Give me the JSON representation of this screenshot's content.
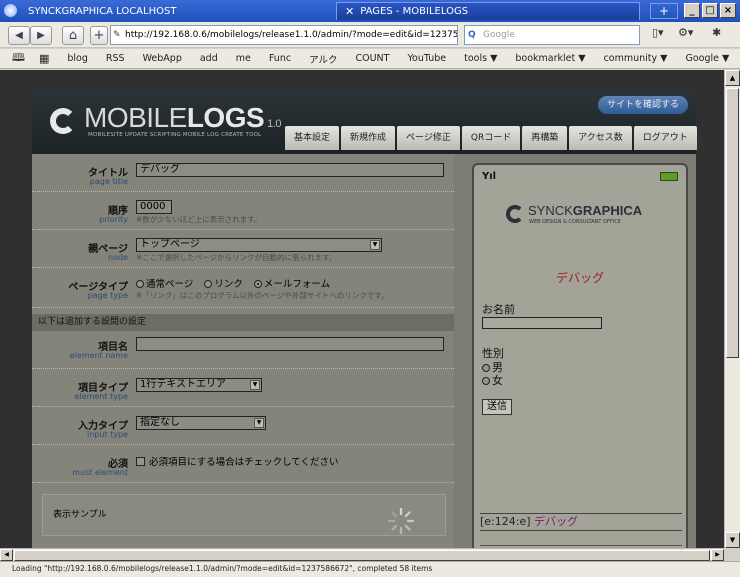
{
  "window": {
    "tab1_title": "SYNCKGRAPHICA LOCALHOST",
    "tab2_title": "PAGES - MOBILELOGS",
    "newtab_label": "+"
  },
  "nav": {
    "back": "◀",
    "forward": "▶",
    "home": "⌂",
    "add": "+",
    "url": "http://192.168.0.6/mobilelogs/release1.1.0/admin/?mode=edit&id=1237586",
    "search_placeholder": "Google"
  },
  "bookmarks": [
    "blog",
    "RSS",
    "WebApp",
    "add",
    "me",
    "Func",
    "アルク",
    "COUNT",
    "YouTube",
    "tools ▼",
    "bookmarklet ▼",
    "community ▼",
    "Google ▼"
  ],
  "header": {
    "logo_light": "MOBILE",
    "logo_bold": "LOGS",
    "version": "1.0",
    "tagline": "MOBILESITE UPDATE SCRIPTING MOBILE LOG CREATE TOOL",
    "visit_button": "サイトを確認する",
    "tabs": [
      "基本設定",
      "新規作成",
      "ページ修正",
      "QRコード",
      "再構築",
      "アクセス数",
      "ログアウト"
    ]
  },
  "form": {
    "title_label": "タイトル",
    "title_sub": "page title",
    "title_value": "デバッグ",
    "priority_label": "順序",
    "priority_sub": "priority",
    "priority_value": "0000",
    "priority_hint": "※数が少ないほど上に表示されます。",
    "node_label": "親ページ",
    "node_sub": "node",
    "node_value": "トップページ",
    "node_hint": "※ここで選択したページからリンクが自動的に張られます。",
    "type_label": "ページタイプ",
    "type_sub": "page type",
    "type_options": [
      "通常ページ",
      "リンク",
      "メールフォーム"
    ],
    "type_selected": "メールフォーム",
    "type_hint": "※「リンク」はこのプログラム以外のページや外部サイトへのリンクです。",
    "section_title": "以下は追加する設問の設定",
    "element_name_label": "項目名",
    "element_name_sub": "element name",
    "element_name_value": "",
    "element_type_label": "項目タイプ",
    "element_type_sub": "element type",
    "element_type_value": "1行テキストエリア",
    "input_type_label": "入力タイプ",
    "input_type_sub": "input type",
    "input_type_value": "指定なし",
    "must_label": "必須",
    "must_sub": "must element",
    "must_checkbox_label": "必須項目にする場合はチェックしてください",
    "sample_label": "表示サンプル"
  },
  "phone": {
    "signal": "Yıl",
    "brand_light": "SYNCK",
    "brand_bold": "GRAPHICA",
    "brand_sub": "WEB DESIGN & CONSULTANT OFFICE",
    "title": "デバッグ",
    "name_label": "お名前",
    "gender_label": "性別",
    "male": "男",
    "female": "女",
    "submit": "送信",
    "footer_key": "[e:124:e]",
    "footer_title": "デバッグ"
  },
  "status": {
    "text": "Loading \"http://192.168.0.6/mobilelogs/release1.1.0/admin/?mode=edit&id=1237586672\", completed 58 items"
  }
}
